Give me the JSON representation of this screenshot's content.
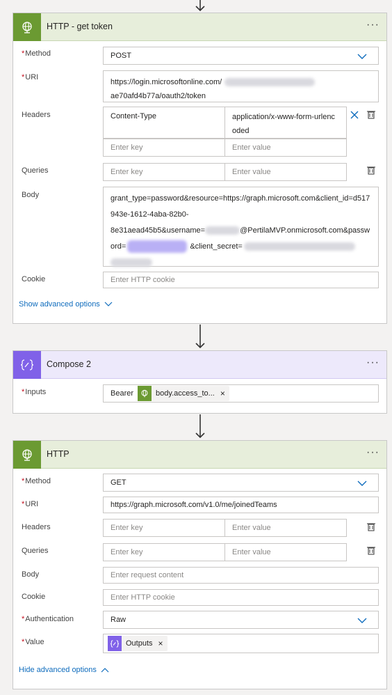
{
  "card1": {
    "title": "HTTP - get token",
    "method_label": "Method",
    "method_value": "POST",
    "uri_label": "URI",
    "uri_line1": "https://login.microsoftonline.com/",
    "uri_line2": "ae70afd4b77a/oauth2/token",
    "headers_label": "Headers",
    "header_key": "Content-Type",
    "header_value_line1": "application/x-www-form-urlenc",
    "header_value_line2": "oded",
    "key_placeholder": "Enter key",
    "value_placeholder": "Enter value",
    "queries_label": "Queries",
    "body_label": "Body",
    "body_line1": "grant_type=password&resource=https://graph.microsoft.com&client_id=d517",
    "body_line2": "943e-1612-4aba-82b0-",
    "body_line3a": "8e31aead45b5&username=",
    "body_line3b": "@PertilaMVP.onmicrosoft.com&passw",
    "body_line4a": "ord=",
    "body_line4b": "&client_secret=",
    "cookie_label": "Cookie",
    "cookie_placeholder": "Enter HTTP cookie",
    "advanced_link": "Show advanced options"
  },
  "card2": {
    "title": "Compose 2",
    "inputs_label": "Inputs",
    "bearer_text": "Bearer",
    "token_label": "body.access_to...",
    "token_remove": "×"
  },
  "card3": {
    "title": "HTTP",
    "method_label": "Method",
    "method_value": "GET",
    "uri_label": "URI",
    "uri_value": "https://graph.microsoft.com/v1.0/me/joinedTeams",
    "headers_label": "Headers",
    "queries_label": "Queries",
    "key_placeholder": "Enter key",
    "value_placeholder": "Enter value",
    "body_label": "Body",
    "body_placeholder": "Enter request content",
    "cookie_label": "Cookie",
    "cookie_placeholder": "Enter HTTP cookie",
    "auth_label": "Authentication",
    "auth_value": "Raw",
    "value_label": "Value",
    "outputs_label": "Outputs",
    "outputs_remove": "×",
    "advanced_link": "Hide advanced options"
  },
  "common": {
    "required_mark": "*",
    "menu_dots": "···"
  },
  "icons": {
    "http": "globe-icon",
    "compose": "compose-icon",
    "delete": "trash-icon",
    "remove": "close-icon",
    "dropdown": "chevron-down-icon",
    "arrow": "arrow-down-icon"
  },
  "colors": {
    "http_accent": "#6b9a32",
    "compose_accent": "#8061e8",
    "link": "#0f6cbd",
    "required": "#c50f1f"
  }
}
